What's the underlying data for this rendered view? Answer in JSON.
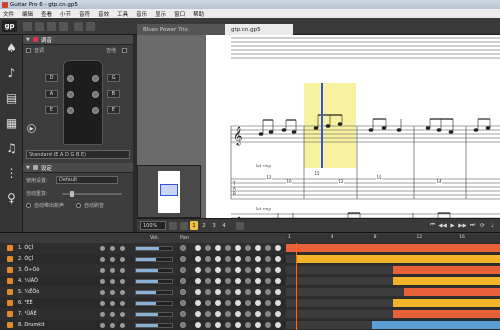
{
  "window": {
    "title": "Guitar Pro 6 - gtp.cn.gp5"
  },
  "menu": [
    "文件",
    "编辑",
    "查看",
    "小节",
    "音符",
    "音效",
    "工具",
    "音乐",
    "显示",
    "窗口",
    "帮助"
  ],
  "logo": "gp",
  "tabs": [
    {
      "label": "Blues Power Trio",
      "active": false
    },
    {
      "label": "gtp.cn.gp5",
      "active": true
    }
  ],
  "left_panel": {
    "section1_title": "调音",
    "row1_left": "音调",
    "row1_right": "吉他",
    "pegs_left": [
      "D",
      "A",
      "E"
    ],
    "pegs_right": [
      "G",
      "B",
      "E"
    ],
    "tuning": "Standard (E A D G B E)",
    "section2_title": "设定",
    "settings": [
      {
        "label": "使用设置:",
        "value": "Default"
      },
      {
        "label": "自动重复:",
        "value": ""
      }
    ],
    "radio1": "自动带出新声",
    "radio2": "自动刷音"
  },
  "score": {
    "let_ring": "let ring",
    "tab_numbers_top": [
      "12",
      "10",
      "12"
    ],
    "tab_numbers_mid": [
      "15",
      "12",
      "15",
      "14"
    ],
    "measure_numbers": [
      "1",
      "2",
      "3",
      "4"
    ]
  },
  "transport": {
    "zoom": "100%",
    "voice_buttons": [
      "1",
      "2",
      "3",
      "4"
    ],
    "active_voice": "1"
  },
  "tracks_header": {
    "vol": "Vol.",
    "pan": "Pan"
  },
  "ruler_ticks": [
    "1",
    "4",
    "8",
    "12",
    "16"
  ],
  "tracks": [
    {
      "name": "1. ÒÇÌ",
      "volume": 0.65,
      "segments": [
        {
          "start": 0.0,
          "end": 1.0,
          "color": "#e8613a"
        }
      ]
    },
    {
      "name": "2. ÒÇÌ",
      "volume": 0.55,
      "segments": [
        {
          "start": 0.05,
          "end": 1.0,
          "color": "#f2b429"
        }
      ]
    },
    {
      "name": "3. Ö÷Òô",
      "volume": 0.6,
      "segments": [
        {
          "start": 0.5,
          "end": 1.0,
          "color": "#e8613a"
        }
      ]
    },
    {
      "name": "4. ¼ÍÂÖ",
      "volume": 0.6,
      "segments": [
        {
          "start": 0.5,
          "end": 1.0,
          "color": "#f2b429"
        }
      ]
    },
    {
      "name": "5. ¼ËÖò",
      "volume": 0.55,
      "segments": [
        {
          "start": 0.55,
          "end": 1.0,
          "color": "#e8613a"
        }
      ]
    },
    {
      "name": "6. ³ÉÈ",
      "volume": 0.55,
      "segments": [
        {
          "start": 0.5,
          "end": 1.0,
          "color": "#f2b429"
        }
      ]
    },
    {
      "name": "7. ¹ÜÄÉ",
      "volume": 0.6,
      "segments": [
        {
          "start": 0.5,
          "end": 1.0,
          "color": "#e8613a"
        }
      ]
    },
    {
      "name": "8. Drumkit",
      "volume": 0.6,
      "segments": [
        {
          "start": 0.4,
          "end": 1.0,
          "color": "#5aa0d6"
        }
      ]
    }
  ]
}
